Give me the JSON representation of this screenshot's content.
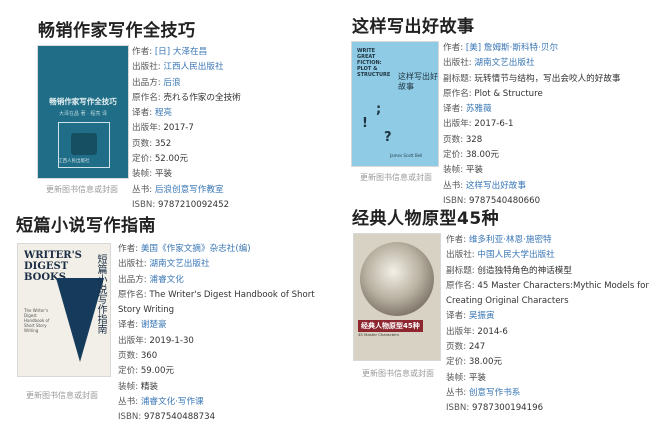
{
  "cover_caption": "更新图书信息或封面",
  "books": [
    {
      "title": "畅销作家写作全技巧",
      "rows": [
        {
          "label": "作者:",
          "value": "[日] 大泽在昌",
          "link": true
        },
        {
          "label": "出版社:",
          "value": "江西人民出版社",
          "link": true
        },
        {
          "label": "出品方:",
          "value": "后浪",
          "link": true
        },
        {
          "label": "原作名:",
          "value": "売れる作家の全技術",
          "link": false
        },
        {
          "label": "译者:",
          "value": "程亮",
          "link": true
        },
        {
          "label": "出版年:",
          "value": "2017-7",
          "link": false
        },
        {
          "label": "页数:",
          "value": "352",
          "link": false
        },
        {
          "label": "定价:",
          "value": "52.00元",
          "link": false
        },
        {
          "label": "装帧:",
          "value": "平装",
          "link": false
        },
        {
          "label": "丛书:",
          "value": "后浪创意写作教室",
          "link": true
        },
        {
          "label": "ISBN:",
          "value": "9787210092452",
          "link": false
        }
      ],
      "cover_text": {
        "title": "畅销作家写作全技巧",
        "sub": "大泽在昌 著 · 程亮 译",
        "foot": "江西人民出版社"
      }
    },
    {
      "title": "这样写出好故事",
      "rows": [
        {
          "label": "作者:",
          "value": "[美] 詹姆斯·斯科特·贝尔",
          "link": true
        },
        {
          "label": "出版社:",
          "value": "湖南文艺出版社",
          "link": true
        },
        {
          "label": "副标题:",
          "value": "玩转情节与结构，写出会咬人的好故事",
          "link": false
        },
        {
          "label": "原作名:",
          "value": "Plot & Structure",
          "link": false
        },
        {
          "label": "译者:",
          "value": "苏雅薇",
          "link": true
        },
        {
          "label": "出版年:",
          "value": "2017-6-1",
          "link": false
        },
        {
          "label": "页数:",
          "value": "328",
          "link": false
        },
        {
          "label": "定价:",
          "value": "38.00元",
          "link": false
        },
        {
          "label": "装帧:",
          "value": "平装",
          "link": false
        },
        {
          "label": "丛书:",
          "value": "这样写出好故事",
          "link": true
        },
        {
          "label": "ISBN:",
          "value": "9787540480660",
          "link": false
        }
      ],
      "cover_text": {
        "en": "WRITE GREAT FICTION: PLOT & STRUCTURE",
        "cn": "这样写出好故事",
        "foot": "James Scott Bell"
      }
    },
    {
      "title": "短篇小说写作指南",
      "rows": [
        {
          "label": "作者:",
          "value": "美国《作家文摘》杂志社(编)",
          "link": true
        },
        {
          "label": "出版社:",
          "value": "湖南文艺出版社",
          "link": true
        },
        {
          "label": "出品方:",
          "value": "浦睿文化",
          "link": true
        },
        {
          "label": "原作名:",
          "value": "The Writer's Digest Handbook of Short Story Writing",
          "link": false,
          "wrap": true
        },
        {
          "label": "译者:",
          "value": "谢楚豪",
          "link": true
        },
        {
          "label": "出版年:",
          "value": "2019-1-30",
          "link": false
        },
        {
          "label": "页数:",
          "value": "360",
          "link": false
        },
        {
          "label": "定价:",
          "value": "59.00元",
          "link": false
        },
        {
          "label": "装帧:",
          "value": "精装",
          "link": false
        },
        {
          "label": "丛书:",
          "value": "浦睿文化·写作课",
          "link": true
        },
        {
          "label": "ISBN:",
          "value": "9787540488734",
          "link": false
        }
      ],
      "cover_text": {
        "en": "WRITER'S DIGEST BOOKS",
        "cn": "短篇小说写作指南",
        "small": "The Writer's Digest Handbook of Short Story Writing"
      }
    },
    {
      "title": "经典人物原型45种",
      "rows": [
        {
          "label": "作者:",
          "value": "维多利亚·林恩·施密特",
          "link": true
        },
        {
          "label": "出版社:",
          "value": "中国人民大学出版社",
          "link": true
        },
        {
          "label": "副标题:",
          "value": "创造独特角色的神话模型",
          "link": false
        },
        {
          "label": "原作名:",
          "value": "45 Master Characters:Mythic Models for Creating Original Characters",
          "link": false,
          "wrap": true
        },
        {
          "label": "译者:",
          "value": "吴振寅",
          "link": true
        },
        {
          "label": "出版年:",
          "value": "2014-6",
          "link": false
        },
        {
          "label": "页数:",
          "value": "247",
          "link": false
        },
        {
          "label": "定价:",
          "value": "38.00元",
          "link": false
        },
        {
          "label": "装帧:",
          "value": "平装",
          "link": false
        },
        {
          "label": "丛书:",
          "value": "创意写作书系",
          "link": true
        },
        {
          "label": "ISBN:",
          "value": "9787300194196",
          "link": false
        }
      ],
      "cover_text": {
        "title": "经典人物原型45种",
        "sub": "45 Master Characters"
      }
    }
  ]
}
